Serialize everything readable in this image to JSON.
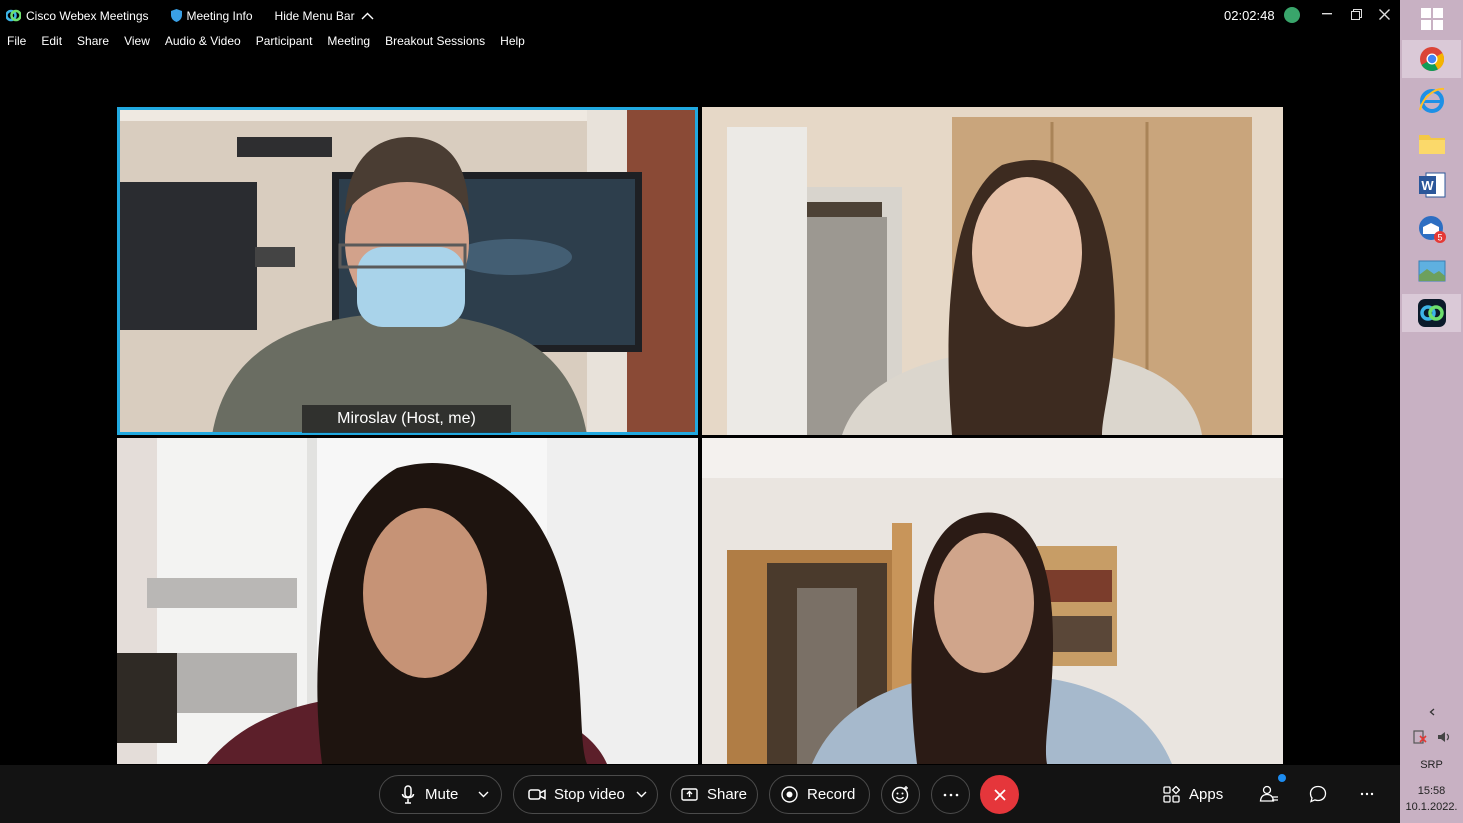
{
  "titlebar": {
    "app_name": "Cisco Webex Meetings",
    "meeting_info": "Meeting Info",
    "hide_menu_bar": "Hide Menu Bar",
    "clock": "02:02:48"
  },
  "menu": [
    "File",
    "Edit",
    "Share",
    "View",
    "Audio & Video",
    "Participant",
    "Meeting",
    "Breakout Sessions",
    "Help"
  ],
  "video": {
    "active_name": "Miroslav  (Host, me)"
  },
  "controls": {
    "mute_label": "Mute",
    "stop_video_label": "Stop video",
    "share_label": "Share",
    "record_label": "Record",
    "apps_label": "Apps"
  },
  "taskbar": {
    "lang": "SRP",
    "time": "15:58",
    "date": "10.1.2022.",
    "mail_badge": "5"
  },
  "colors": {
    "active_outline": "#21a9e0",
    "end_call": "#e5363b",
    "taskbar": "#c8b1c3"
  }
}
